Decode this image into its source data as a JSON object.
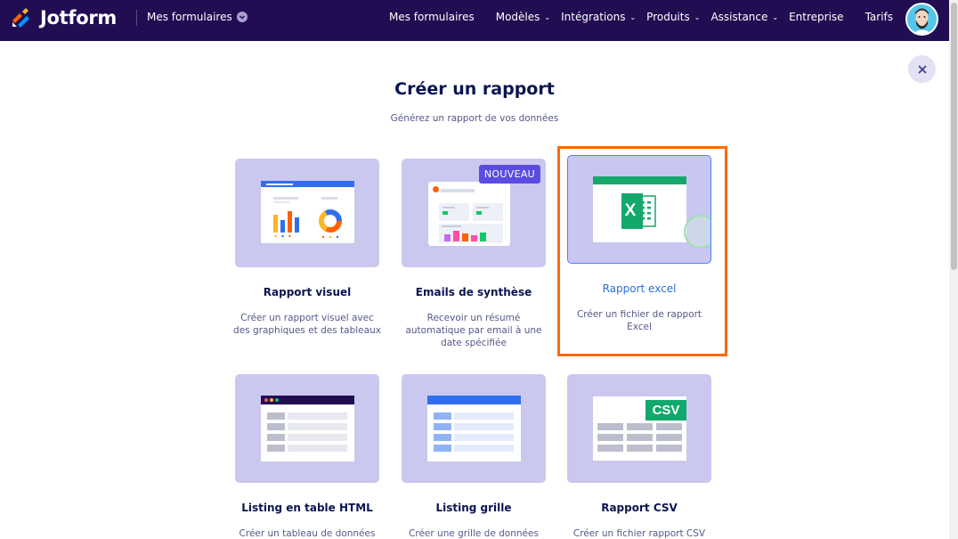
{
  "header": {
    "brand": "Jotform",
    "my_forms_dropdown": "Mes formulaires",
    "nav": [
      {
        "label": "Mes formulaires",
        "has_dropdown": false
      },
      {
        "label": "Modèles",
        "has_dropdown": true
      },
      {
        "label": "Intégrations",
        "has_dropdown": true
      },
      {
        "label": "Produits",
        "has_dropdown": true
      },
      {
        "label": "Assistance",
        "has_dropdown": true
      },
      {
        "label": "Entreprise",
        "has_dropdown": false
      },
      {
        "label": "Tarifs",
        "has_dropdown": false
      }
    ]
  },
  "dialog": {
    "title": "Créer un rapport",
    "subtitle": "Générez un rapport de vos données",
    "close_icon": "close-icon"
  },
  "report_types": [
    {
      "name": "Rapport visuel",
      "description": "Créer un rapport visuel avec des graphiques et des tableaux",
      "badge": ""
    },
    {
      "name": "Emails de synthèse",
      "description": "Recevoir un résumé automatique par email à une date spécifiée",
      "badge": "NOUVEAU"
    },
    {
      "name": "Rapport excel",
      "description": "Créer un fichier de rapport Excel",
      "badge": "",
      "selected": true,
      "icon_text": "X"
    },
    {
      "name": "Listing en table HTML",
      "description": "Créer un tableau de données",
      "badge": ""
    },
    {
      "name": "Listing grille",
      "description": "Créer une grille de données",
      "badge": ""
    },
    {
      "name": "Rapport CSV",
      "description": "Créer un fichier rapport CSV",
      "badge": "",
      "icon_text": "CSV"
    }
  ],
  "colors": {
    "nav_bg": "#220c52",
    "card_bg": "#cbc8ef",
    "highlight": "#fb6a05",
    "selected_title": "#2b6fdc",
    "excel_green": "#14a86b",
    "csv_green": "#0fa96b"
  }
}
